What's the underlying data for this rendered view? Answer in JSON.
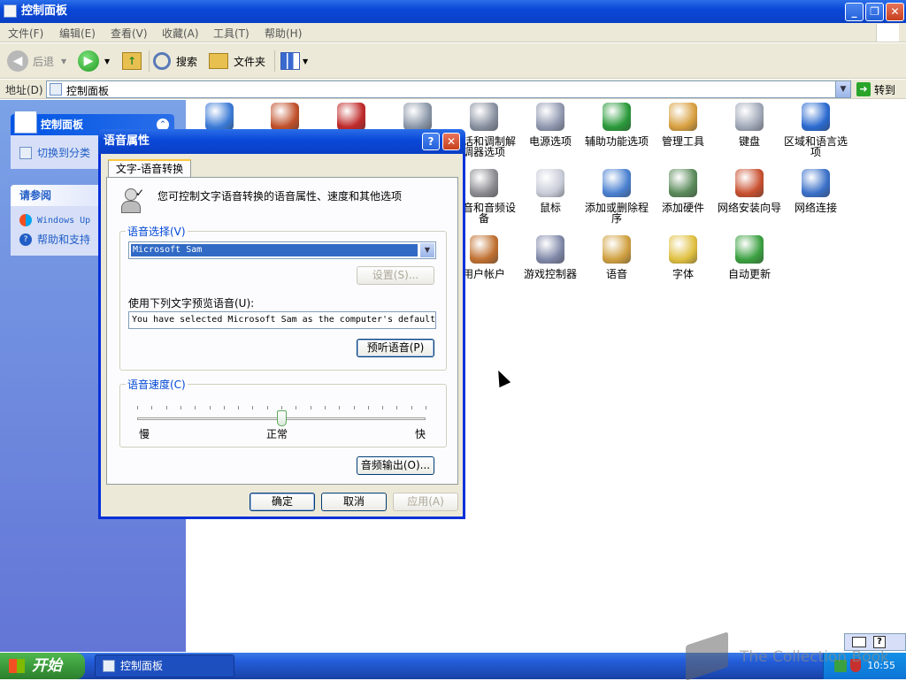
{
  "window": {
    "title": "控制面板",
    "min": "_",
    "max": "❐",
    "close": "✕"
  },
  "menu": [
    "文件(F)",
    "编辑(E)",
    "查看(V)",
    "收藏(A)",
    "工具(T)",
    "帮助(H)"
  ],
  "toolbar": {
    "back": "后退",
    "search": "搜索",
    "folders": "文件夹"
  },
  "address": {
    "label": "地址(D)",
    "value": "控制面板",
    "go": "转到"
  },
  "leftpane": {
    "panel_title": "控制面板",
    "switch_view": "切换到分类",
    "see_also_title": "请参阅",
    "see_also": [
      "Windows Up",
      "帮助和支持"
    ]
  },
  "icons": [
    {
      "label": "",
      "color": "#3b7ad6"
    },
    {
      "label": "",
      "color": "#c0502a"
    },
    {
      "label": "",
      "color": "#c02a2a"
    },
    {
      "label": "",
      "color": "#8a96a8"
    },
    {
      "label": "电话和调制解调器选项",
      "color": "#8890a0"
    },
    {
      "label": "电源选项",
      "color": "#9098b0"
    },
    {
      "label": "辅助功能选项",
      "color": "#2a9a3a"
    },
    {
      "label": "管理工具",
      "color": "#d8a040"
    },
    {
      "label": "键盘",
      "color": "#a0a8b8"
    },
    {
      "label": "区域和语言选项",
      "color": "#2a6ad0"
    },
    {
      "label": "声音和音频设备",
      "color": "#8a8a90"
    },
    {
      "label": "鼠标",
      "color": "#c8ccd8"
    },
    {
      "label": "添加或删除程序",
      "color": "#4a80d0"
    },
    {
      "label": "添加硬件",
      "color": "#5a8a5a"
    },
    {
      "label": "网络安装向导",
      "color": "#c85030"
    },
    {
      "label": "网络连接",
      "color": "#3a70c8"
    },
    {
      "label": "用户帐户",
      "color": "#c07030"
    },
    {
      "label": "游戏控制器",
      "color": "#8088a8"
    },
    {
      "label": "语音",
      "color": "#d0a040"
    },
    {
      "label": "字体",
      "color": "#e0c040"
    },
    {
      "label": "自动更新",
      "color": "#3aa040"
    }
  ],
  "dialog": {
    "title": "语音属性",
    "help": "?",
    "close": "✕",
    "tab": "文字-语音转换",
    "description": "您可控制文字语音转换的语音属性、速度和其他选项",
    "voice_group": "语音选择(V)",
    "voice_value": "Microsoft Sam",
    "settings": "设置(S)...",
    "preview_label": "使用下列文字预览语音(U):",
    "preview_text": "You have selected Microsoft Sam as the computer's default",
    "preview_btn": "预听语音(P)",
    "speed_group": "语音速度(C)",
    "speed_slow": "慢",
    "speed_normal": "正常",
    "speed_fast": "快",
    "speed_level": 0.5,
    "audio_output": "音频输出(O)...",
    "ok": "确定",
    "cancel": "取消",
    "apply": "应用(A)"
  },
  "taskbar": {
    "start": "开始",
    "task": "控制面板",
    "time": "10:55"
  },
  "watermark": "The Collection Book"
}
